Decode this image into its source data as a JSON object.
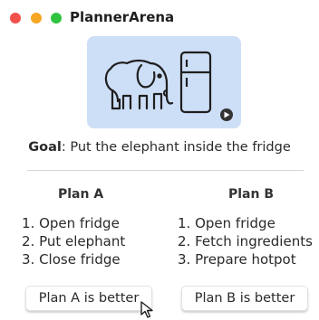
{
  "window": {
    "title": "PlannerArena",
    "controls": [
      "close",
      "minimize",
      "maximize"
    ]
  },
  "hero": {
    "icons": [
      "elephant-icon",
      "fridge-icon",
      "play-icon"
    ],
    "background": "#cddff7"
  },
  "goal": {
    "label": "Goal",
    "text": ": Put the elephant inside the fridge"
  },
  "plans": {
    "a": {
      "title": "Plan A",
      "steps": [
        "1. Open fridge",
        "2. Put elephant",
        "3. Close fridge"
      ],
      "button_label": "Plan A is better"
    },
    "b": {
      "title": "Plan B",
      "steps": [
        "1. Open fridge",
        "2. Fetch ingredients",
        "3. Prepare hotpot"
      ],
      "button_label": "Plan B is better"
    }
  }
}
